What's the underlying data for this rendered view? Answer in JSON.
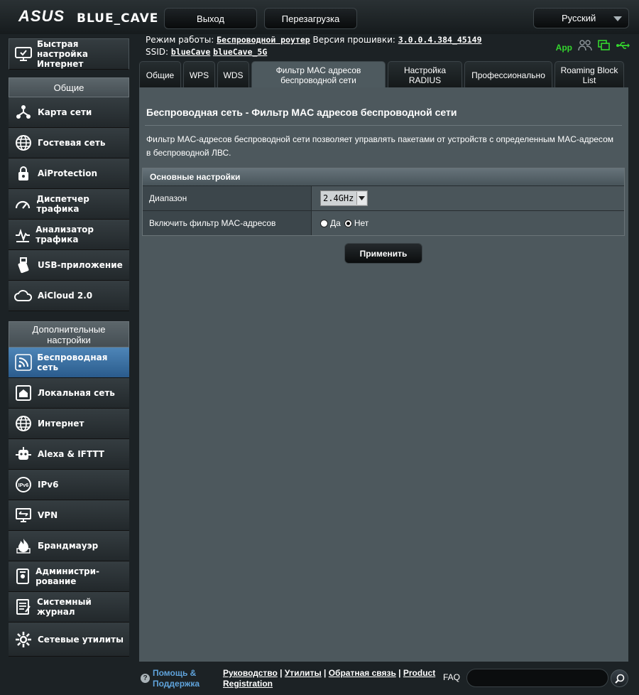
{
  "header": {
    "logo": "ASUS",
    "model": "BLUE_CAVE",
    "logout_label": "Выход",
    "reboot_label": "Перезагрузка",
    "language": "Русский"
  },
  "info": {
    "mode_label": "Режим работы:",
    "mode_value": "Беспроводной роутер",
    "fw_label": "Версия прошивки:",
    "fw_value": "3.0.0.4.384_45149",
    "ssid_label": "SSID:",
    "ssid_1": "blueCave",
    "ssid_2": "blueCave_5G",
    "app_label": "App"
  },
  "sidebar": {
    "quick_setup": "Быстрая настройка Интернет",
    "general_header": "Общие",
    "general_items": [
      {
        "label": "Карта сети",
        "icon": "network-map-icon"
      },
      {
        "label": "Гостевая сеть",
        "icon": "globe-icon"
      },
      {
        "label": "AiProtection",
        "icon": "lock-icon"
      },
      {
        "label": "Диспетчер трафика",
        "icon": "gauge-icon"
      },
      {
        "label": "Анализатор трафика",
        "icon": "pulse-icon"
      },
      {
        "label": "USB-приложение",
        "icon": "usb-icon"
      },
      {
        "label": "AiCloud 2.0",
        "icon": "cloud-icon"
      }
    ],
    "advanced_header": "Дополнительные настройки",
    "advanced_items": [
      {
        "label": "Беспроводная сеть",
        "icon": "wifi-icon",
        "active": true
      },
      {
        "label": "Локальная сеть",
        "icon": "home-icon"
      },
      {
        "label": "Интернет",
        "icon": "globe-icon"
      },
      {
        "label": "Alexa & IFTTT",
        "icon": "alexa-icon"
      },
      {
        "label": "IPv6",
        "icon": "ipv6-icon"
      },
      {
        "label": "VPN",
        "icon": "vpn-icon"
      },
      {
        "label": "Брандмауэр",
        "icon": "firewall-icon"
      },
      {
        "label": "Администри-рование",
        "icon": "admin-icon"
      },
      {
        "label": "Системный журнал",
        "icon": "log-icon"
      },
      {
        "label": "Сетевые утилиты",
        "icon": "gear-icon"
      }
    ]
  },
  "tabs": [
    {
      "label": "Общие"
    },
    {
      "label": "WPS"
    },
    {
      "label": "WDS"
    },
    {
      "label": "Фильтр MAC адресов беспроводной сети",
      "active": true
    },
    {
      "label": "Настройка RADIUS"
    },
    {
      "label": "Профессионально"
    },
    {
      "label": "Roaming Block List"
    }
  ],
  "content": {
    "title": "Беспроводная сеть - Фильтр MAC адресов беспроводной сети",
    "description": "Фильтр MAC-адресов беспроводной сети позволяет управлять пакетами от устройств с определенным MAC-адресом в беспроводной ЛВС.",
    "table_header": "Основные настройки",
    "band_label": "Диапазон",
    "band_value": "2.4GHz",
    "filter_label": "Включить фильтр MAC-адресов",
    "radio_yes": "Да",
    "radio_no": "Нет",
    "radio_selected": "no",
    "apply_label": "Применить"
  },
  "footer": {
    "help": "Помощь & Поддержка",
    "link_manual": "Руководство",
    "link_utils": "Утилиты",
    "link_feedback": "Обратная связь",
    "link_product": "Product Registration",
    "faq": "FAQ"
  }
}
